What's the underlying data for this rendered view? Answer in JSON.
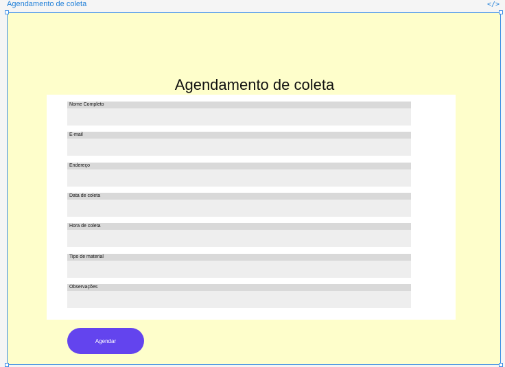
{
  "frame": {
    "title": "Agendamento de coleta",
    "code_icon": "</>"
  },
  "page": {
    "heading": "Agendamento de coleta"
  },
  "form": {
    "fields": [
      {
        "label": "Nome Completo",
        "value": ""
      },
      {
        "label": "E-mail",
        "value": ""
      },
      {
        "label": "Endereço",
        "value": ""
      },
      {
        "label": "Data de coleta",
        "value": ""
      },
      {
        "label": "Hora de coleta",
        "value": ""
      },
      {
        "label": "Tipo de material",
        "value": ""
      },
      {
        "label": "Observações",
        "value": ""
      }
    ],
    "submit_label": "Agendar"
  },
  "colors": {
    "frame_background": "#fefecb",
    "selection": "#3d8ee6",
    "button": "#6344ee"
  }
}
